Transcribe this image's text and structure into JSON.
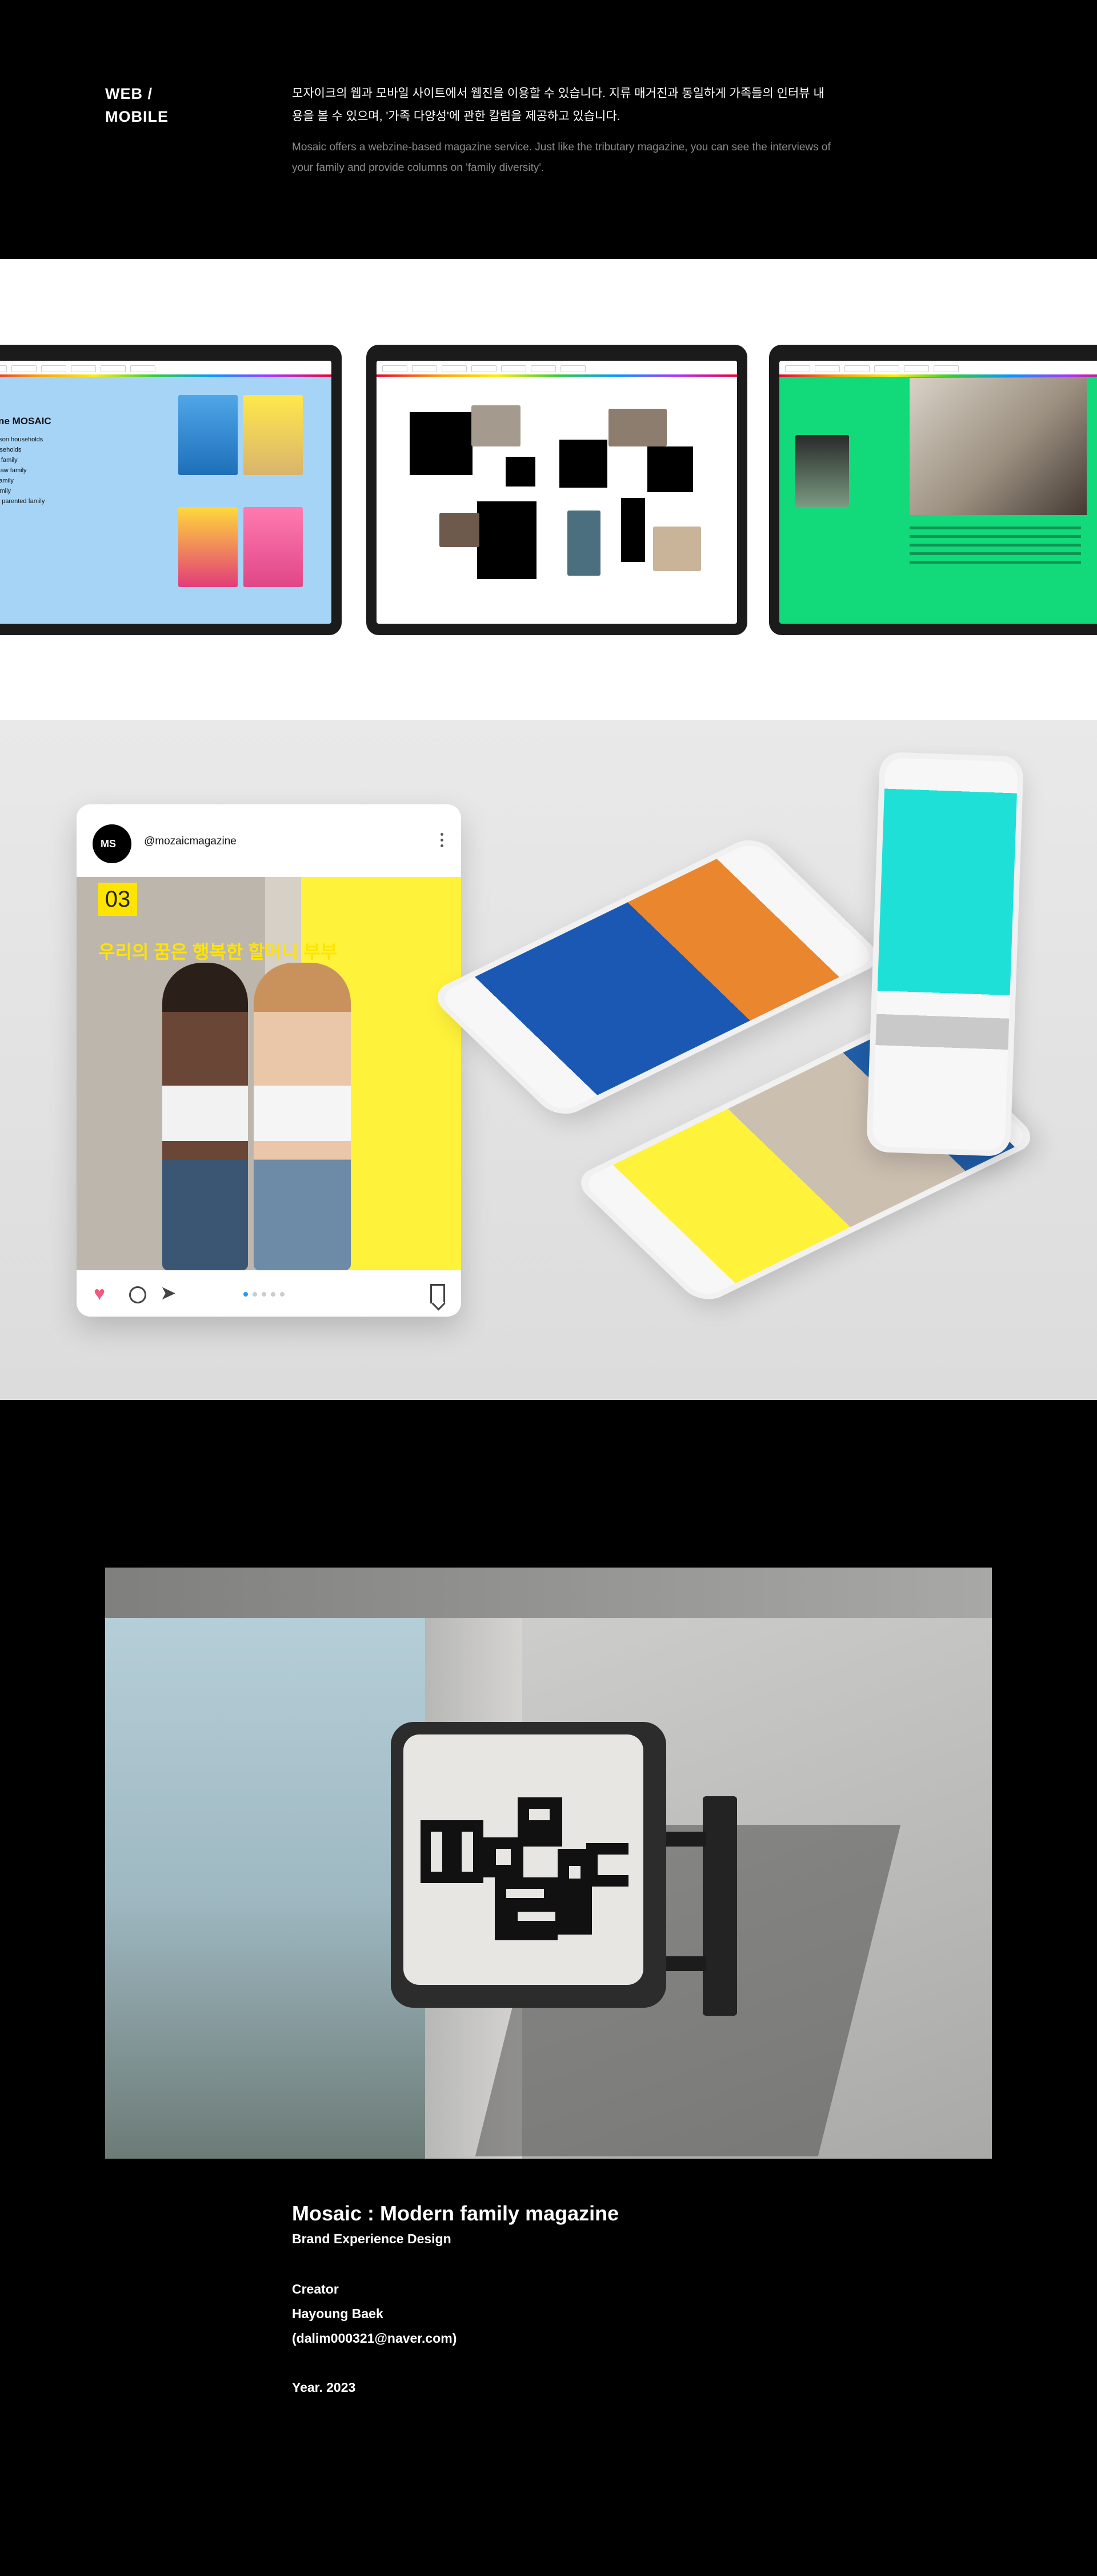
{
  "intro": {
    "heading": "WEB / MOBILE",
    "korean_text": "모자이크의 웹과 모바일 사이트에서 웹진을 이용할 수 있습니다. 지류 매거진과 동일하게 가족들의 인터뷰 내용을 볼 수 있으며, '가족 다양성'에 관한 칼럼을 제공하고 있습니다.",
    "english_text": "Mosaic offers a webzine-based magazine service. Just like the tributary magazine, you can see the interviews of your family and provide columns on 'family diversity'."
  },
  "tablets": {
    "left_screen_title": "gazine MOSAIC",
    "left_screen_list": [
      "gle-person households",
      "ely households",
      "-parent family",
      "nman- law family",
      "arried family",
      "ptive family",
      "me-sex parented family"
    ]
  },
  "instagram": {
    "handle": "@mozaicmagazine",
    "avatar_text": "MS",
    "issue_number": "03",
    "headline": "우리의 꿈은 행복한 할머니 부부",
    "accent_color": "#ffe400"
  },
  "colors": {
    "tablet_blue": "#a6d4f7",
    "tablet_green": "#12d97a",
    "like_pink": "#f05a7e",
    "pager_blue": "#1aa1f0"
  },
  "credits": {
    "title": "Mosaic : Modern family magazine",
    "subtitle": "Brand Experience Design",
    "creator_label": "Creator",
    "creator_name": "Hayoung Baek",
    "creator_email": "(dalim000321@naver.com)",
    "year": "Year. 2023"
  }
}
